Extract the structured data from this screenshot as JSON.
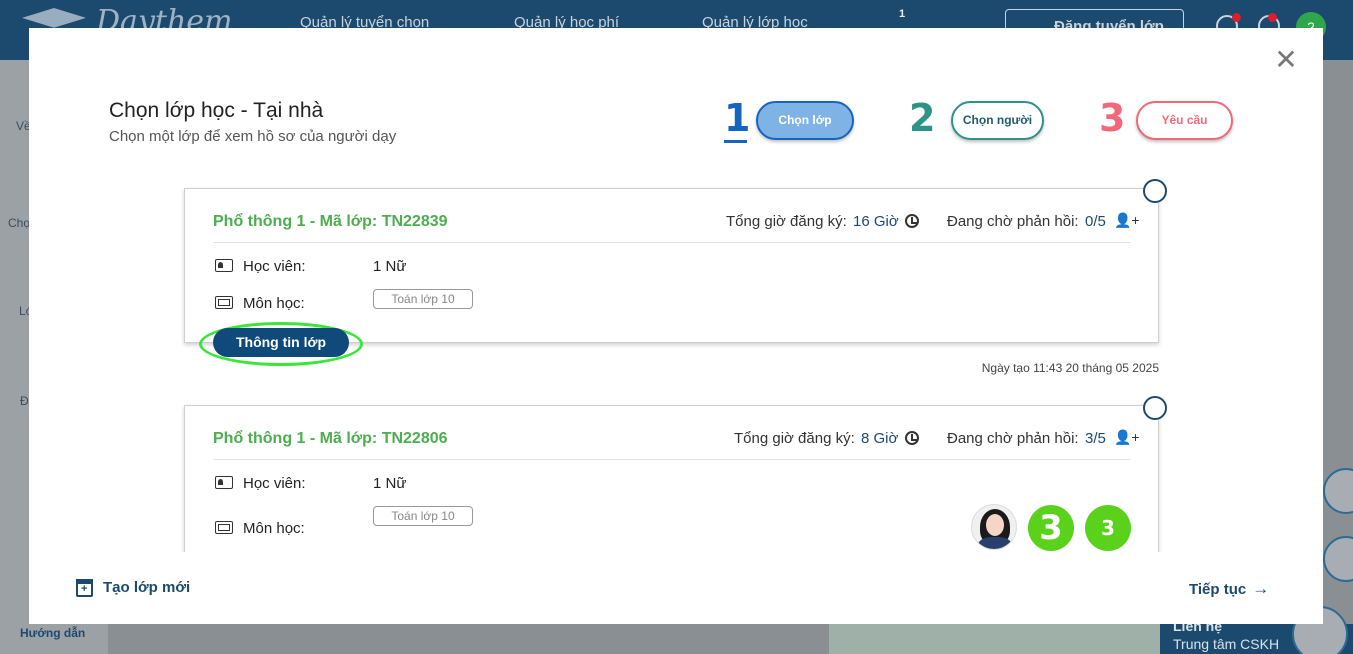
{
  "background": {
    "logo_text": "Daythem",
    "nav": [
      "Quản lý tuyển chọn",
      "Quản lý học phí",
      "Quản lý lớp học"
    ],
    "message_badge": "1",
    "post_button": "Đăng tuyển lớp",
    "avatar_letter": "2",
    "sidebar_items": [
      "Về",
      "Chọ",
      "Lớ",
      "Đ"
    ],
    "sidebar_help": "Hướng dẫn",
    "support": {
      "title": "Liên hệ",
      "subtitle": "Trung tâm CSKH"
    }
  },
  "modal": {
    "close_glyph": "✕",
    "title": "Chọn lớp học - Tại nhà",
    "subtitle": "Chọn một lớp để xem hồ sơ của người dạy",
    "steps": [
      {
        "num": "1",
        "label": "Chọn lớp"
      },
      {
        "num": "2",
        "label": "Chọn người"
      },
      {
        "num": "3",
        "label": "Yêu cầu"
      }
    ],
    "classes": [
      {
        "title": "Phổ thông 1 - Mã lớp: TN22839",
        "hours_label": "Tổng giờ đăng ký:",
        "hours_value": "16 Giờ",
        "pending_label": "Đang chờ phản hồi:",
        "pending_value": "0/5",
        "student_label": "Học viên:",
        "student_value": "1 Nữ",
        "subject_label": "Môn học:",
        "subject_tag": "Toán lớp 10",
        "info_button": "Thông tin lớp",
        "created": "Ngày tạo 11:43 20 tháng 05 2025"
      },
      {
        "title": "Phổ thông 1 - Mã lớp: TN22806",
        "hours_label": "Tổng giờ đăng ký:",
        "hours_value": "8 Giờ",
        "pending_label": "Đang chờ phản hồi:",
        "pending_value": "3/5",
        "student_label": "Học viên:",
        "student_value": "1 Nữ",
        "subject_label": "Môn học:",
        "subject_tag": "Toán lớp 10",
        "badge_big": "3",
        "badge_small": "3"
      }
    ],
    "footer": {
      "new_class": "Tạo lớp mới",
      "next": "Tiếp tục",
      "next_arrow": "→"
    }
  },
  "colors": {
    "brand_navy": "#1c4a6e",
    "green_title": "#4cae4f",
    "step1": "#1565c0",
    "step2": "#2e9387",
    "step3": "#f2687a",
    "highlight": "#39e639",
    "badge_green": "#5ad11b"
  }
}
